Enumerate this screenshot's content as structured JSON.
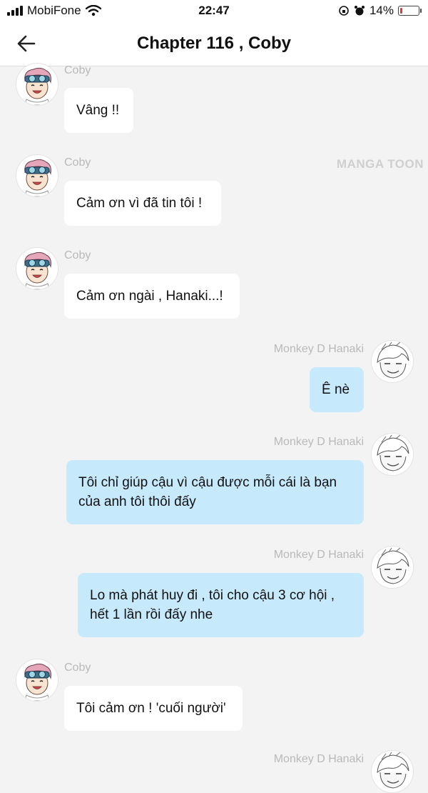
{
  "status_bar": {
    "carrier": "MobiFone",
    "time": "22:47",
    "battery_percent": "14%",
    "battery_level": 0.14
  },
  "header": {
    "title": "Chapter 116 , Coby",
    "back_icon": "arrow-left-icon"
  },
  "watermark": "MANGA TOON",
  "messages": [
    {
      "sender": "Coby",
      "side": "left",
      "text": "Vâng !!"
    },
    {
      "sender": "Coby",
      "side": "left",
      "text": "Cảm ơn vì đã tin tôi !"
    },
    {
      "sender": "Coby",
      "side": "left",
      "text": "Cảm ơn ngài , Hanaki...!"
    },
    {
      "sender": "Monkey D Hanaki",
      "side": "right",
      "text": "Ê nè"
    },
    {
      "sender": "Monkey D Hanaki",
      "side": "right",
      "text": "Tôi chỉ giúp cậu vì cậu được mỗi cái là bạn của anh tôi thôi đấy"
    },
    {
      "sender": "Monkey D Hanaki",
      "side": "right",
      "text": "Lo mà phát huy đi , tôi cho cậu 3 cơ hội , hết 1 lần rồi đấy nhe"
    },
    {
      "sender": "Coby",
      "side": "left",
      "text": "Tôi cảm ơn ! 'cuối người'"
    },
    {
      "sender": "Monkey D Hanaki",
      "side": "right",
      "text": ""
    }
  ],
  "colors": {
    "background": "#f3f3f3",
    "left_bubble": "#ffffff",
    "right_bubble": "#c6e9fb",
    "name_text": "#b9b9b9"
  }
}
